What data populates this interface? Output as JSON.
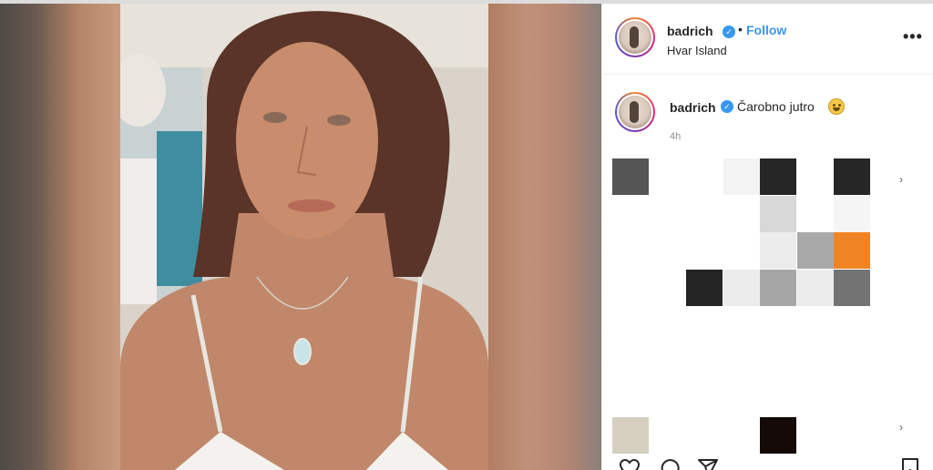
{
  "post": {
    "username": "badrich",
    "verified_mark": "✓",
    "separator": "•",
    "follow_label": "Follow",
    "location": "Hvar Island",
    "more_label": "•••"
  },
  "caption": {
    "username": "badrich",
    "verified_mark": "✓",
    "text": "Čarobno jutro",
    "emoji": "grinning-face-emoji",
    "time": "4h"
  },
  "comments_area": {
    "chevron": "›",
    "pixel_colors": [
      "#555555",
      "#f3f3f3",
      "#262626",
      "#262626",
      "#d8d8d8",
      "#f5f5f5",
      "#ececec",
      "#a9a9a9",
      "#f08424",
      "#252525",
      "#ececec",
      "#a6a6a6",
      "#ececec",
      "#737373",
      "#d6cfbf",
      "#150a07"
    ]
  },
  "actions": {
    "icons": [
      "heart-icon",
      "comment-icon",
      "share-icon",
      "save-icon"
    ]
  }
}
